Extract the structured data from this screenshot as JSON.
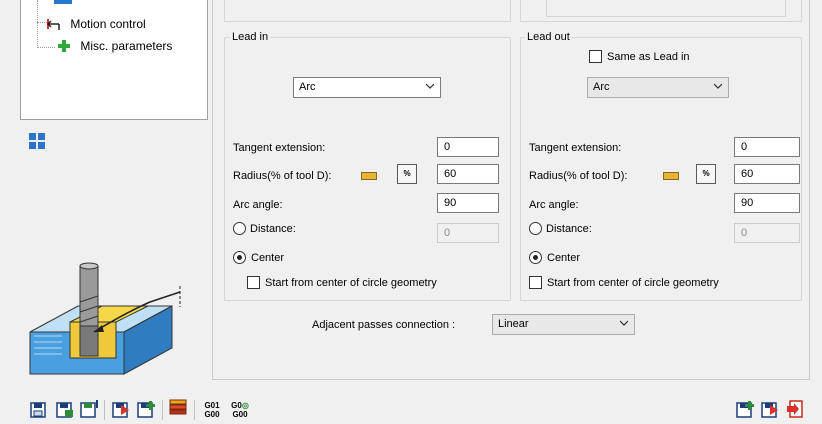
{
  "tree": {
    "items": [
      {
        "label": "Motion control",
        "icon": "motion-control-icon"
      },
      {
        "label": "Misc. parameters",
        "icon": "green-plus-icon"
      }
    ]
  },
  "lead_in": {
    "title": "Lead in",
    "type_value": "Arc",
    "tangent_extension_label": "Tangent  extension:",
    "tangent_extension_value": "0",
    "radius_label": "Radius(% of tool D):",
    "radius_value": "60",
    "arc_angle_label": "Arc angle:",
    "arc_angle_value": "90",
    "distance_label": "Distance:",
    "distance_value": "0",
    "center_label": "Center",
    "start_center_label": "Start from center of circle geometry",
    "pct_button": "%"
  },
  "lead_out": {
    "title": "Lead out",
    "same_as_label": "Same as Lead in",
    "type_value": "Arc",
    "tangent_extension_label": "Tangent  extension:",
    "tangent_extension_value": "0",
    "radius_label": "Radius(% of tool D):",
    "radius_value": "60",
    "arc_angle_label": "Arc angle:",
    "arc_angle_value": "90",
    "distance_label": "Distance:",
    "distance_value": "0",
    "center_label": "Center",
    "start_center_label": "Start from center of circle geometry",
    "pct_button": "%"
  },
  "adjacent": {
    "label": "Adjacent passes connection :",
    "value": "Linear"
  },
  "toolbar": {
    "g01_top": "G01",
    "g01_bottom": "G00",
    "g0_top": "G0",
    "g0_bottom": "G00"
  },
  "colors": {
    "tool_body": "#8c8c8c",
    "block_blue": "#4a9fe0",
    "block_yellow": "#f5d84a",
    "save_green": "#2e8b3a",
    "arrow_red": "#d9322b"
  }
}
